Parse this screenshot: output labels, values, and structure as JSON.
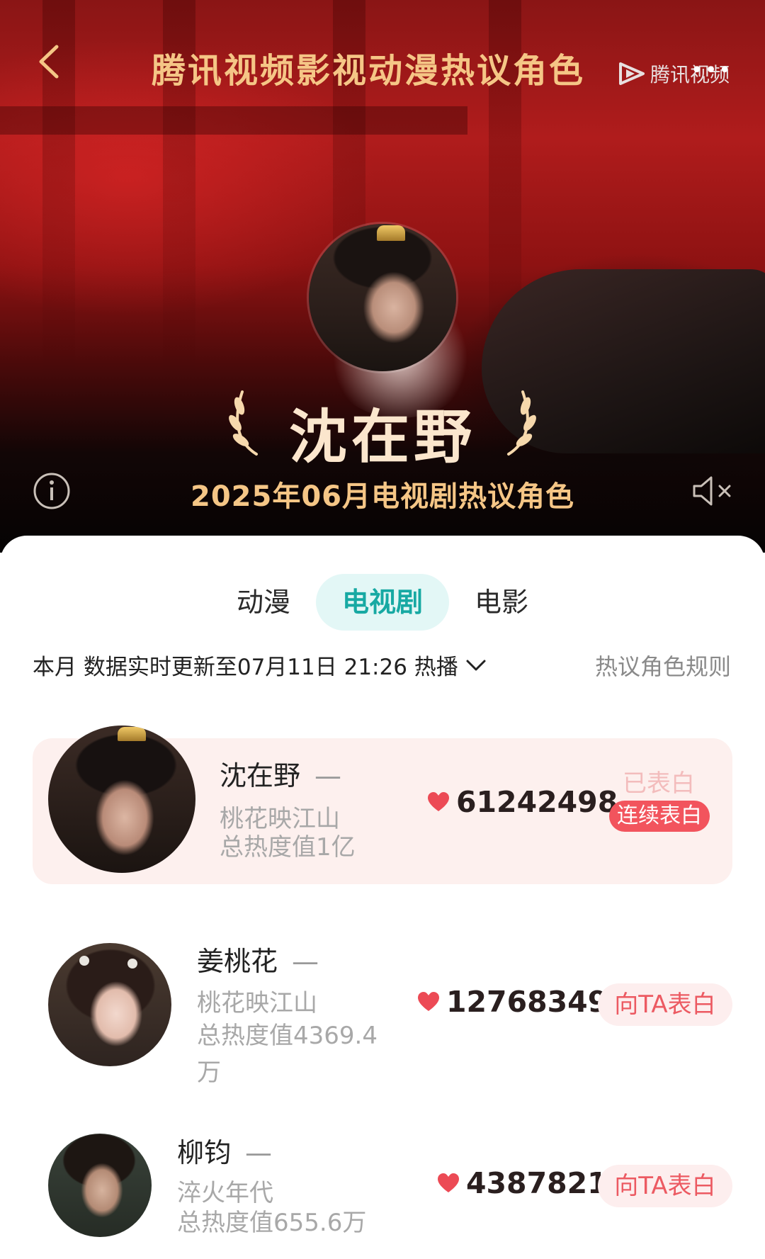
{
  "header": {
    "title": "腾讯视频影视动漫热议角色",
    "brand": "腾讯视频",
    "more": "•••"
  },
  "hero": {
    "name": "沈在野",
    "subtitle": "2025年06月电视剧热议角色"
  },
  "tabs": [
    {
      "label": "动漫",
      "active": false
    },
    {
      "label": "电视剧",
      "active": true
    },
    {
      "label": "电影",
      "active": false
    }
  ],
  "meta": {
    "status": "本月 数据实时更新至07月11日 21:26 热播",
    "rules": "热议角色规则"
  },
  "characters": [
    {
      "name": "沈在野",
      "rank_change": "—",
      "drama": "桃花映江山",
      "total": "总热度值1亿",
      "score": "61242498",
      "confessed_label": "已表白",
      "action": "连续表白"
    },
    {
      "name": "姜桃花",
      "rank_change": "—",
      "drama": "桃花映江山",
      "total": "总热度值4369.4万",
      "score": "12768349",
      "action": "向TA表白"
    },
    {
      "name": "柳钧",
      "rank_change": "—",
      "drama": "淬火年代",
      "total": "总热度值655.6万",
      "score": "4387821",
      "action": "向TA表白"
    }
  ],
  "colors": {
    "accent_teal": "#17a9a3",
    "heart_red": "#ec4a55",
    "gold": "#f5c686"
  }
}
